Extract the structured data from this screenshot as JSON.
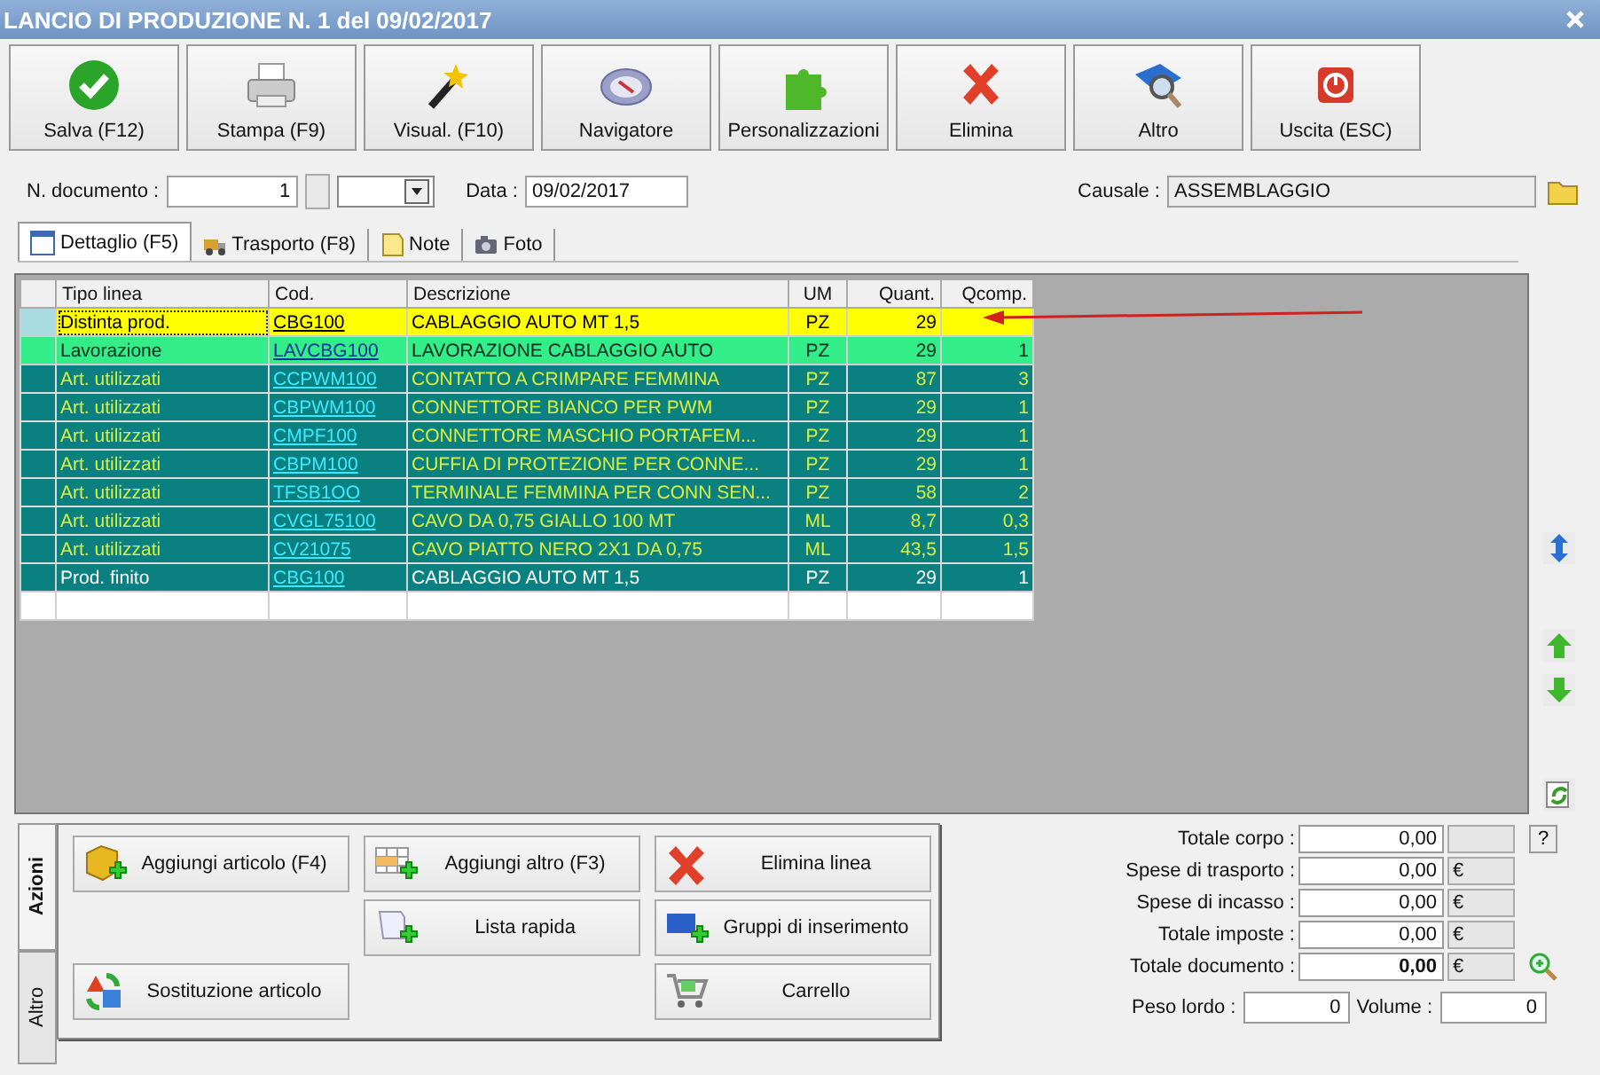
{
  "window": {
    "title": "LANCIO DI PRODUZIONE N. 1 del 09/02/2017"
  },
  "toolbar": [
    {
      "label": "Salva (F12)"
    },
    {
      "label": "Stampa (F9)"
    },
    {
      "label": "Visual. (F10)"
    },
    {
      "label": "Navigatore"
    },
    {
      "label": "Personalizzazioni"
    },
    {
      "label": "Elimina"
    },
    {
      "label": "Altro"
    },
    {
      "label": "Uscita (ESC)"
    }
  ],
  "header": {
    "doc_number_label": "N. documento :",
    "doc_number": "1",
    "date_label": "Data :",
    "date": "09/02/2017",
    "causale_label": "Causale :",
    "causale": "ASSEMBLAGGIO"
  },
  "tabs": [
    {
      "label": "Dettaglio (F5)",
      "selected": true
    },
    {
      "label": "Trasporto (F8)",
      "selected": false
    },
    {
      "label": "Note",
      "selected": false
    },
    {
      "label": "Foto",
      "selected": false
    }
  ],
  "table": {
    "columns": [
      "Tipo linea",
      "Cod.",
      "Descrizione",
      "UM",
      "Quant.",
      "Qcomp."
    ],
    "rows": [
      {
        "kind": "bom",
        "selected": true,
        "type": "Distinta prod.",
        "code": "CBG100",
        "description": "CABLAGGIO AUTO MT 1,5",
        "um": "PZ",
        "qty": "29"
      },
      {
        "kind": "process",
        "selected": false,
        "type": "Lavorazione",
        "code": "LAVCBG100",
        "description": "LAVORAZIONE CABLAGGIO AUTO",
        "um": "PZ",
        "qty": "29",
        "qcomp": "1"
      },
      {
        "kind": "component",
        "selected": false,
        "type": "Art. utilizzati",
        "code": "CCPWM100",
        "description": "CONTATTO A CRIMPARE FEMMINA",
        "um": "PZ",
        "qty": "87",
        "qcomp": "3"
      },
      {
        "kind": "component",
        "selected": false,
        "type": "Art. utilizzati",
        "code": "CBPWM100",
        "description": "CONNETTORE BIANCO PER PWM",
        "um": "PZ",
        "qty": "29",
        "qcomp": "1"
      },
      {
        "kind": "component",
        "selected": false,
        "type": "Art. utilizzati",
        "code": "CMPF100",
        "description": "CONNETTORE MASCHIO PORTAFEM...",
        "um": "PZ",
        "qty": "29",
        "qcomp": "1"
      },
      {
        "kind": "component",
        "selected": false,
        "type": "Art. utilizzati",
        "code": "CBPM100",
        "description": "CUFFIA DI PROTEZIONE PER CONNE...",
        "um": "PZ",
        "qty": "29",
        "qcomp": "1"
      },
      {
        "kind": "component",
        "selected": false,
        "type": "Art. utilizzati",
        "code": "TFSB1OO",
        "description": "TERMINALE FEMMINA PER CONN SEN...",
        "um": "PZ",
        "qty": "58",
        "qcomp": "2"
      },
      {
        "kind": "component",
        "selected": false,
        "type": "Art. utilizzati",
        "code": "CVGL75100",
        "description": "CAVO DA 0,75 GIALLO 100 MT",
        "um": "ML",
        "qty": "8,7",
        "qcomp": "0,3"
      },
      {
        "kind": "component",
        "selected": false,
        "type": "Art. utilizzati",
        "code": "CV21075",
        "description": "CAVO PIATTO NERO 2X1 DA 0,75",
        "um": "ML",
        "qty": "43,5",
        "qcomp": "1,5"
      },
      {
        "kind": "product",
        "selected": false,
        "type": "Prod. finito",
        "code": "CBG100",
        "description": "CABLAGGIO AUTO MT 1,5",
        "um": "PZ",
        "qty": "29",
        "qcomp": "1"
      }
    ]
  },
  "actions": {
    "side_tabs": [
      {
        "label": "Azioni",
        "selected": true
      },
      {
        "label": "Altro",
        "selected": false
      }
    ],
    "buttons": [
      {
        "label": "Aggiungi articolo (F4)"
      },
      {
        "label": "Aggiungi altro (F3)"
      },
      {
        "label": "Elimina linea"
      },
      {
        "label": "Lista rapida"
      },
      {
        "label": "Gruppi di inserimento"
      },
      {
        "label": "Sostituzione articolo"
      },
      {
        "label": "Carrello"
      }
    ]
  },
  "totals": [
    {
      "label": "Totale corpo :",
      "value": "0,00",
      "bold": false
    },
    {
      "label": "Spese di trasporto :",
      "value": "0,00",
      "currency": "€",
      "bold": false
    },
    {
      "label": "Spese di incasso :",
      "value": "0,00",
      "currency": "€",
      "bold": false
    },
    {
      "label": "Totale imposte :",
      "value": "0,00",
      "currency": "€",
      "bold": false
    },
    {
      "label": "Totale documento :",
      "value": "0,00",
      "currency": "€",
      "bold": true
    }
  ],
  "help_button": "?",
  "weights": {
    "gross_label": "Peso lordo :",
    "gross": "0",
    "volume_label": "Volume :",
    "volume": "0"
  }
}
